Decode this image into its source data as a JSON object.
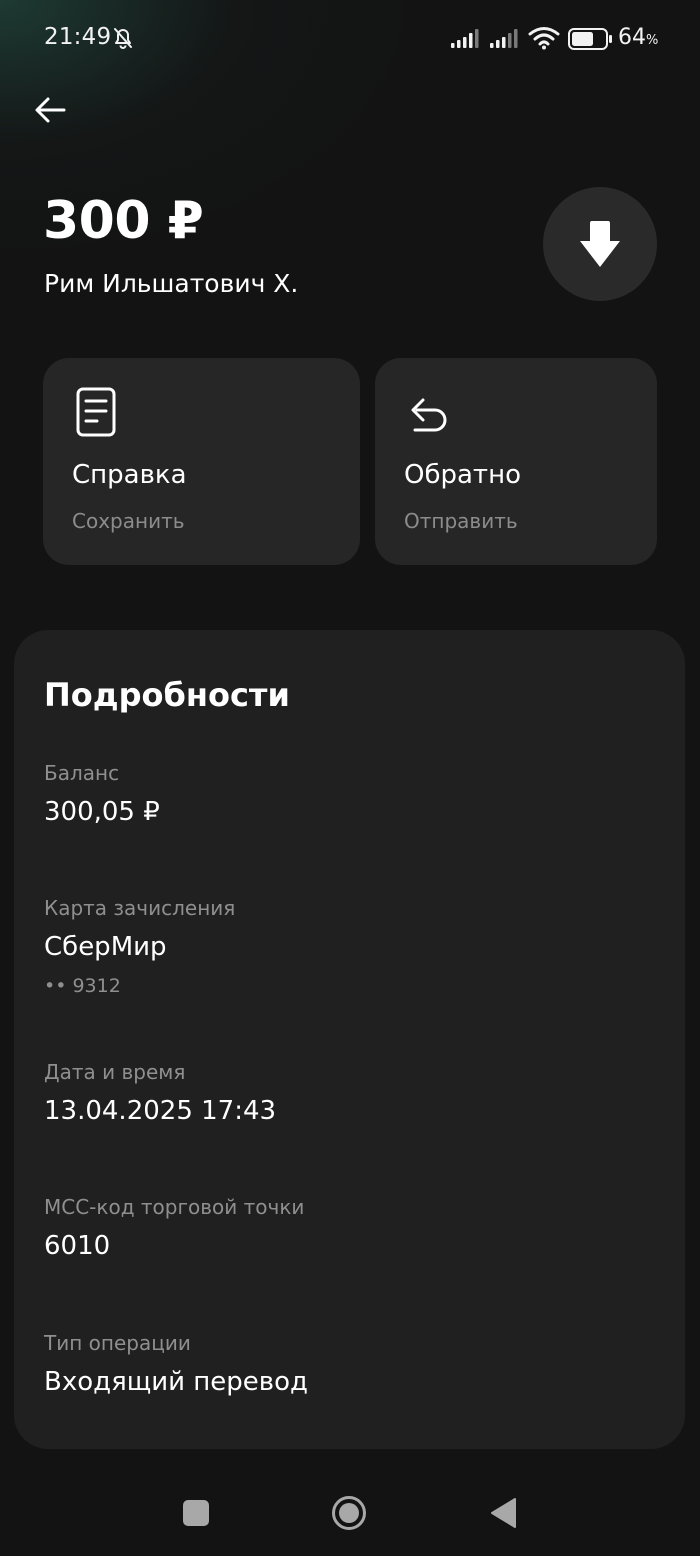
{
  "status_bar": {
    "time": "21:49",
    "battery_level": "64",
    "battery_unit": "%",
    "icons": [
      "bell-muted-icon",
      "signal-icon",
      "signal-icon",
      "wifi-icon",
      "battery-icon"
    ]
  },
  "header": {
    "back_icon": "arrow-left-icon",
    "amount": "300 ₽",
    "sender": "Рим Ильшатович Х.",
    "type_icon": "arrow-down-icon"
  },
  "actions": [
    {
      "icon": "document-icon",
      "title": "Справка",
      "subtitle": "Сохранить"
    },
    {
      "icon": "return-arrow-icon",
      "title": "Обратно",
      "subtitle": "Отправить"
    }
  ],
  "details": {
    "title": "Подробности",
    "fields": [
      {
        "label": "Баланс",
        "value": "300,05 ₽"
      },
      {
        "label": "Карта зачисления",
        "value": "СберМир",
        "extra": "•• 9312"
      },
      {
        "label": "Дата и время",
        "value": "13.04.2025 17:43"
      },
      {
        "label": "MCC-код торговой точки",
        "value": "6010"
      },
      {
        "label": "Тип операции",
        "value": "Входящий перевод"
      }
    ]
  },
  "nav_bar": {
    "icons": [
      "recents-square-icon",
      "home-circle-icon",
      "back-triangle-icon"
    ]
  },
  "colors": {
    "background": "#131313",
    "card": "#262626",
    "panel": "#202020",
    "secondary_text": "#8f8f8f",
    "accent_glow": "#1e3a33"
  }
}
